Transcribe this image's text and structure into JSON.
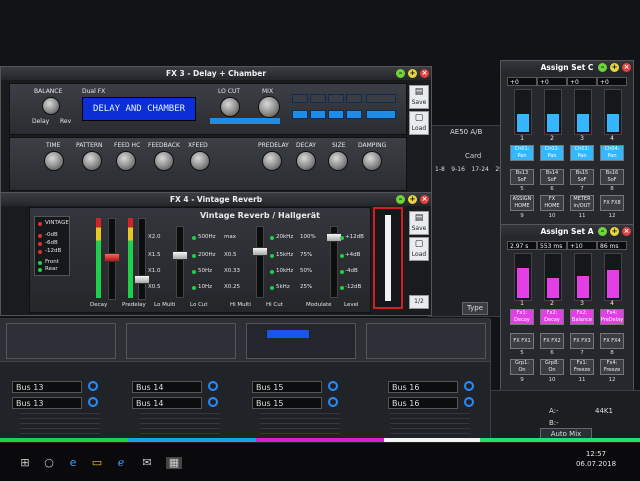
{
  "fx3": {
    "title": "FX 3 - Delay + Chamber",
    "labels": {
      "balance": "BALANCE",
      "dual_fx": "Dual FX",
      "lo_cut": "LO CUT",
      "mix": "MIX",
      "delay": "Delay",
      "rev": "Rev",
      "time": "TIME",
      "pattern": "PATTERN",
      "feed_hc": "FEED HC",
      "feedback": "FEEDBACK",
      "xfeed": "XFEED",
      "predelay": "PREDELAY",
      "decay": "DECAY",
      "size": "SIZE",
      "damping": "DAMPING"
    },
    "lcd": "DELAY AND CHAMBER",
    "save": "Save",
    "load": "Load"
  },
  "fx4": {
    "title": "FX 4 - Vintage Reverb",
    "subtitle": "Vintage Reverb / Hallgerät",
    "mode_labels": [
      "VINTAGE",
      "-0dB",
      "-6dB",
      "-12dB",
      "Front",
      "Rear"
    ],
    "freq_labels_a": [
      "X2.0",
      "X1.5",
      "X1.0",
      "X0.5"
    ],
    "freq_labels_b": [
      "500Hz",
      "200Hz",
      "50Hz",
      "10Hz"
    ],
    "freq_labels_c": [
      "max",
      "X0.5",
      "X0.33",
      "X0.25"
    ],
    "freq_labels_d": [
      "20kHz",
      "15kHz",
      "10kHz",
      "5kHz"
    ],
    "freq_labels_e": [
      "100%",
      "75%",
      "50%",
      "25%"
    ],
    "freq_labels_f": [
      "+12dB",
      "+4dB",
      "-4dB",
      "-12dB"
    ],
    "bottom_labels": [
      "Decay",
      "Predelay",
      "Lo Multi",
      "Lo Cut",
      "Hi Multi",
      "Hi Cut",
      "Modulate",
      "Level"
    ],
    "save": "Save",
    "load": "Load",
    "page": "1/2"
  },
  "assign_c": {
    "title": "Assign Set C",
    "values": [
      "+0",
      "+0",
      "+0",
      "+0"
    ],
    "numbers": [
      "1",
      "2",
      "3",
      "4"
    ],
    "pan_buttons": [
      "Ch01: Pan",
      "Ch02: Pan",
      "Ch03: Pan",
      "Ch04: Pan"
    ],
    "row_a": [
      "Bs13 SoF",
      "Bs14 SoF",
      "Bs15 SoF",
      "Bs16 SoF"
    ],
    "row_a_nums": [
      "5",
      "6",
      "7",
      "8"
    ],
    "row_b": [
      "ASSIGN HOME",
      "FX HOME",
      "METER in/OUT",
      "FX FX8"
    ],
    "row_b_nums": [
      "9",
      "10",
      "11",
      "12"
    ]
  },
  "assign_a": {
    "title": "Assign Set A",
    "values": [
      "2.97 s",
      "553 ms",
      "+10",
      "86 ms"
    ],
    "numbers": [
      "1",
      "2",
      "3",
      "4"
    ],
    "fx_buttons": [
      "Fx1: Decay",
      "Fx2: Decay",
      "Fx2: Balance",
      "Fx4: PreDelay"
    ],
    "row_a": [
      "FX FX1",
      "FX FX2",
      "FX FX3",
      "FX FX4"
    ],
    "row_a_nums": [
      "5",
      "6",
      "7",
      "8"
    ],
    "row_b": [
      "Grp1: On",
      "Grp8: On",
      "Fx1: Freeze",
      "Fx4: Freeze"
    ],
    "row_b_nums": [
      "9",
      "10",
      "11",
      "12"
    ]
  },
  "mixer": {
    "buses": [
      [
        "Bus 13",
        "Bus 13"
      ],
      [
        "Bus 14",
        "Bus 14"
      ],
      [
        "Bus 15",
        "Bus 15"
      ],
      [
        "Bus 16",
        "Bus 16"
      ]
    ]
  },
  "background": {
    "ae50": "AE50 A/B",
    "card": "Card",
    "card_cols": [
      "1-8",
      "9-16",
      "17-24",
      "25"
    ],
    "type": "Type"
  },
  "bottom_right": {
    "a": "A:-",
    "b": "B:-",
    "rate": "44K1",
    "auto_mix": "Auto Mix"
  },
  "taskbar": {
    "time": "12:57",
    "date": "06.07.2018"
  },
  "colors": {
    "lcd_blue": "#0a2fd6",
    "assign_c_accent": "#35b7ff",
    "assign_a_accent": "#e23fe6",
    "led_green": "#1ed04a",
    "led_red": "#e03030"
  }
}
